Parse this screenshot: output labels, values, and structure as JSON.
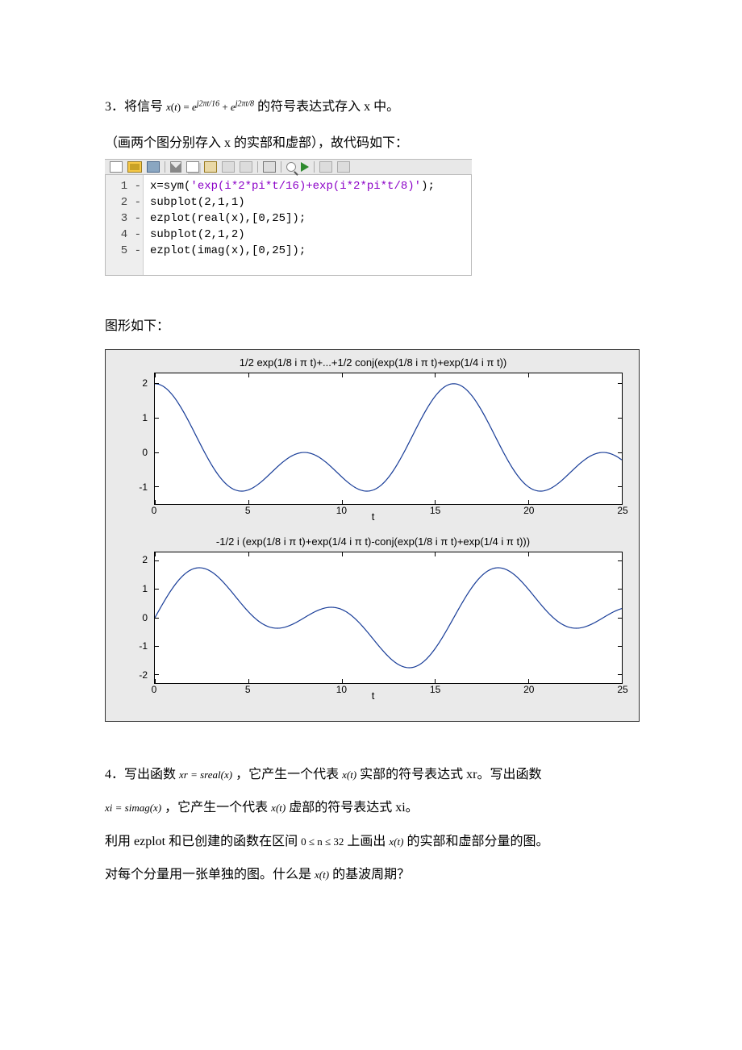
{
  "q3": {
    "prefix": "3．将信号 ",
    "expr_html": "x(t) = e^{ j2πt/16 } + e^{ j2πt/8 }",
    "suffix": " 的符号表达式存入 x 中。",
    "note": "（画两个图分别存入 x 的实部和虚部），故代码如下："
  },
  "editor": {
    "gutter": [
      " 1 -",
      " 2 -",
      " 3 -",
      " 4 -",
      " 5 -"
    ],
    "lines": [
      {
        "pre": "x=sym(",
        "str": "'exp(i*2*pi*t/16)+exp(i*2*pi*t/8)'",
        "post": ");"
      },
      {
        "pre": "subplot(2,1,1)",
        "str": "",
        "post": ""
      },
      {
        "pre": "ezplot(real(x),[0,25]);",
        "str": "",
        "post": ""
      },
      {
        "pre": "subplot(2,1,2)",
        "str": "",
        "post": ""
      },
      {
        "pre": "ezplot(imag(x),[0,25]);",
        "str": "",
        "post": ""
      }
    ]
  },
  "figcaption": "图形如下：",
  "chart_data": [
    {
      "type": "line",
      "title": "1/2 exp(1/8 i π t)+...+1/2 conj(exp(1/8 i π t)+exp(1/4 i π t))",
      "xlabel": "t",
      "xlim": [
        0,
        25
      ],
      "ylim": [
        -1.5,
        2.3
      ],
      "xticks": [
        0,
        5,
        10,
        15,
        20,
        25
      ],
      "yticks": [
        -1,
        0,
        1,
        2
      ],
      "series": [
        {
          "name": "real(x)",
          "expr": "cos(2*pi*t/16)+cos(2*pi*t/8)"
        }
      ]
    },
    {
      "type": "line",
      "title": "-1/2 i (exp(1/8 i π t)+exp(1/4 i π t)-conj(exp(1/8 i π t)+exp(1/4 i π t)))",
      "xlabel": "t",
      "xlim": [
        0,
        25
      ],
      "ylim": [
        -2.3,
        2.3
      ],
      "xticks": [
        0,
        5,
        10,
        15,
        20,
        25
      ],
      "yticks": [
        -2,
        -1,
        0,
        1,
        2
      ],
      "series": [
        {
          "name": "imag(x)",
          "expr": "sin(2*pi*t/16)+sin(2*pi*t/8)"
        }
      ]
    }
  ],
  "q4": {
    "l1a": "4．写出函数 ",
    "l1b": "xr = sreal(x)",
    "l1c": " ，它产生一个代表 ",
    "l1d": "x(t)",
    "l1e": " 实部的符号表达式 xr。写出函数",
    "l2a": "xi = simag(x)",
    "l2b": " ，它产生一个代表 ",
    "l2c": "x(t)",
    "l2d": " 虚部的符号表达式 xi。",
    "l3a": "利用 ezplot 和已创建的函数在区间 ",
    "l3b": "0 ≤ n ≤ 32",
    "l3c": " 上画出 ",
    "l3d": "x(t)",
    "l3e": " 的实部和虚部分量的图。",
    "l4a": "对每个分量用一张单独的图。什么是 ",
    "l4b": "x(t)",
    "l4c": " 的基波周期？"
  }
}
